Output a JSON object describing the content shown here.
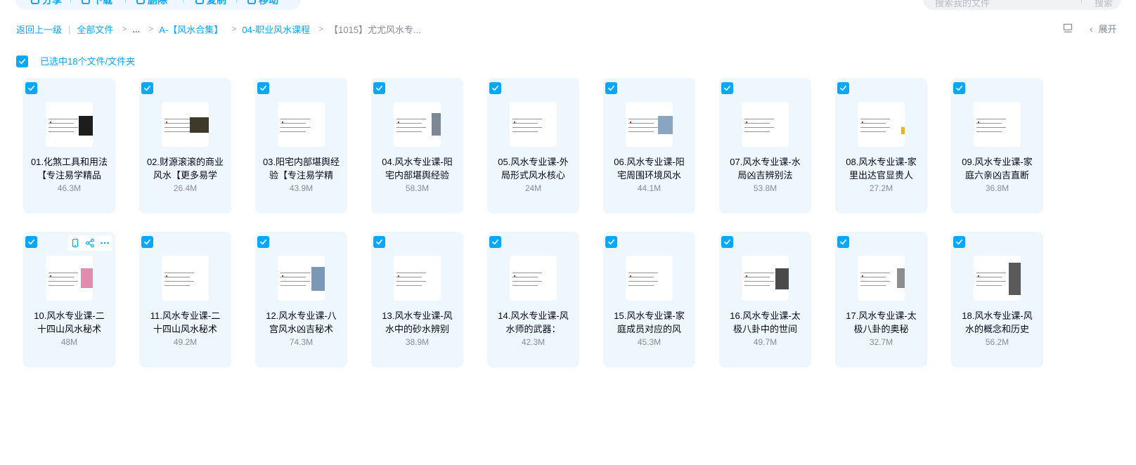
{
  "toolbar": {
    "buttons": [
      {
        "label": "分享",
        "icon": "share-icon"
      },
      {
        "label": "下载",
        "icon": "download-icon"
      },
      {
        "label": "删除",
        "icon": "delete-icon"
      },
      {
        "label": "复制",
        "icon": "copy-icon"
      },
      {
        "label": "移动",
        "icon": "move-icon"
      }
    ]
  },
  "search": {
    "placeholder": "搜索我的文件",
    "button": "搜索"
  },
  "breadcrumb": {
    "back": "返回上一级",
    "root": "全部文件",
    "ellipsis": "...",
    "level1": "A-【风水合集】",
    "level2": "04-职业风水课程",
    "current": "【1015】尤尤风水专..."
  },
  "expand_label": "展开",
  "selection": {
    "label": "已选中18个文件/文件夹"
  },
  "accent_color": "#06a7ff",
  "files": [
    {
      "line1": "01.化煞工具和用法",
      "line2": "【专注易学精品",
      "size": "46.3M",
      "checked": true
    },
    {
      "line1": "02.财源滚滚的商业",
      "line2": "风水【更多易学",
      "size": "26.4M",
      "checked": true
    },
    {
      "line1": "03.阳宅内部堪舆经",
      "line2": "验【专注易学精",
      "size": "43.9M",
      "checked": true
    },
    {
      "line1": "04.风水专业课-阳",
      "line2": "宅内部堪舆经验",
      "size": "58.3M",
      "checked": true
    },
    {
      "line1": "05.风水专业课-外",
      "line2": "局形式风水核心",
      "size": "24M",
      "checked": true
    },
    {
      "line1": "06.风水专业课-阳",
      "line2": "宅周围环境风水",
      "size": "44.1M",
      "checked": true
    },
    {
      "line1": "07.风水专业课-水",
      "line2": "局凶吉辨别法",
      "size": "53.8M",
      "checked": true
    },
    {
      "line1": "08.风水专业课-家",
      "line2": "里出达官显贵人",
      "size": "27.2M",
      "checked": true
    },
    {
      "line1": "09.风水专业课-家",
      "line2": "庭六亲凶吉直断",
      "size": "36.8M",
      "checked": true
    },
    {
      "line1": "10.风水专业课-二",
      "line2": "十四山风水秘术",
      "size": "48M",
      "checked": true
    },
    {
      "line1": "11.风水专业课-二",
      "line2": "十四山风水秘术",
      "size": "49.2M",
      "checked": true
    },
    {
      "line1": "12.风水专业课-八",
      "line2": "宫风水凶吉秘术",
      "size": "74.3M",
      "checked": true
    },
    {
      "line1": "13.风水专业课-风",
      "line2": "水中的砂水辨别",
      "size": "38.9M",
      "checked": true
    },
    {
      "line1": "14.风水专业课-风",
      "line2": "水师的武器：",
      "size": "42.3M",
      "checked": true
    },
    {
      "line1": "15.风水专业课-家",
      "line2": "庭成员对应的风",
      "size": "45.3M",
      "checked": true
    },
    {
      "line1": "16.风水专业课-太",
      "line2": "极八卦中的世间",
      "size": "49.7M",
      "checked": true
    },
    {
      "line1": "17.风水专业课-太",
      "line2": "极八卦的奥秘",
      "size": "32.7M",
      "checked": true
    },
    {
      "line1": "18.风水专业课-风",
      "line2": "水的概念和历史",
      "size": "56.2M",
      "checked": true
    }
  ]
}
